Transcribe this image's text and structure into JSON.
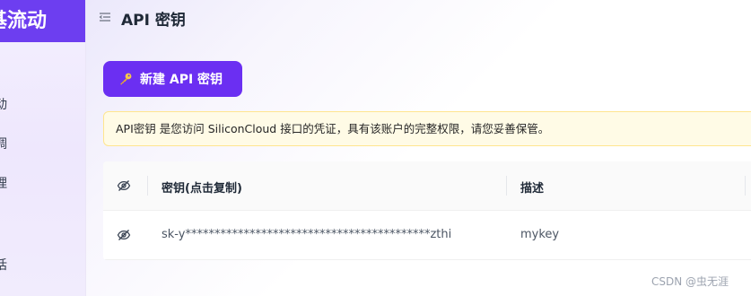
{
  "sidebar": {
    "brand": "基流动",
    "fragments": [
      "动",
      "调",
      "理",
      "话"
    ]
  },
  "header": {
    "title": "API 密钥"
  },
  "actions": {
    "new_key_label": "新建 API 密钥"
  },
  "notice": {
    "text": "API密钥 是您访问 SiliconCloud 接口的凭证，具有该账户的完整权限，请您妥善保管。"
  },
  "table": {
    "columns": {
      "key": "密钥(点击复制)",
      "description": "描述"
    },
    "rows": [
      {
        "key": "sk-y******************************************zthi",
        "description": "mykey"
      }
    ]
  },
  "watermark": "CSDN @虫无涯",
  "colors": {
    "brand": "#6d3ef0",
    "button": "#6b2ff2",
    "notice_bg": "#fffbe6",
    "notice_border": "#ffe58f"
  }
}
